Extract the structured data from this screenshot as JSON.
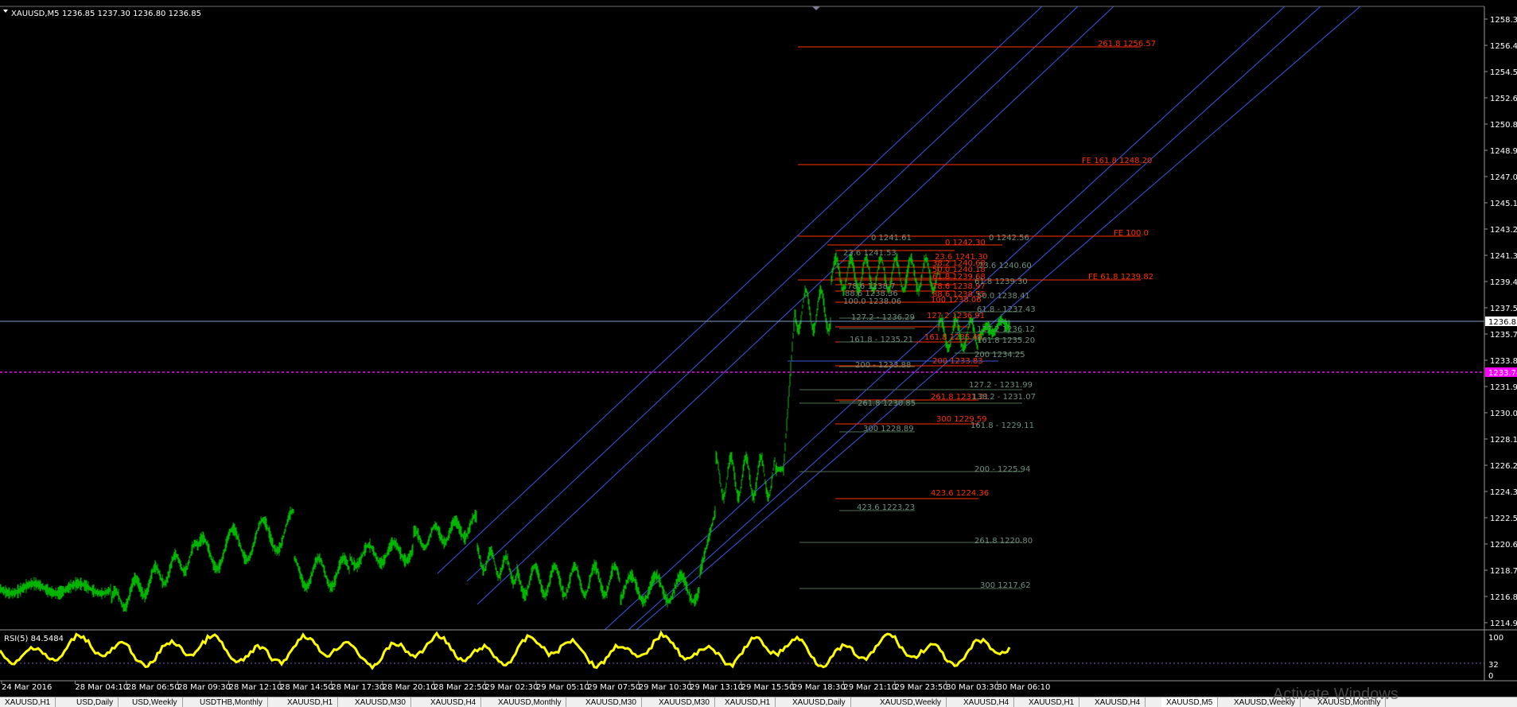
{
  "chart_header": {
    "symbol_tf": "XAUUSD,M5",
    "ohlc": "1236.85 1237.30 1236.80 1236.85"
  },
  "price_scale": {
    "labels": [
      "1258.34",
      "1256.49",
      "1254.59",
      "1252.69",
      "1250.84",
      "1248.94",
      "1247.04",
      "1245.14",
      "1243.29",
      "1241.39",
      "1239.49",
      "1237.59",
      "1235.74",
      "1233.84",
      "1231.94",
      "1230.09",
      "1228.19",
      "1226.29",
      "1224.39",
      "1222.54",
      "1220.64",
      "1218.74",
      "1216.89",
      "1214.99"
    ],
    "current_price": "1236.85",
    "level_tag": "1233.74"
  },
  "rsi": {
    "label": "RSI(5) 84.5484",
    "levels": [
      "100",
      "32",
      "0"
    ]
  },
  "time_axis": [
    "24 Mar 2016",
    "28 Mar 04:10",
    "28 Mar 06:50",
    "28 Mar 09:30",
    "28 Mar 12:10",
    "28 Mar 14:50",
    "28 Mar 17:30",
    "28 Mar 20:10",
    "28 Mar 22:50",
    "29 Mar 02:30",
    "29 Mar 05:10",
    "29 Mar 07:50",
    "29 Mar 10:30",
    "29 Mar 13:10",
    "29 Mar 15:50",
    "29 Mar 18:30",
    "29 Mar 21:10",
    "29 Mar 23:50",
    "30 Mar 03:30",
    "30 Mar 06:10"
  ],
  "fib_labels": {
    "red": [
      "261.8 1256.57",
      "FE 161.8 1248.20",
      "FE 100.0",
      "FE 61.8 1239.82",
      "0 1242.30",
      "23.6 1241.30",
      "38.2 1240.68",
      "50.0 1240.18",
      "61.8 1239.68",
      "78.6 1238.97",
      "88.6 1238.55",
      "100 1238.06",
      "127.2 1236.91",
      "161.8 1235.45",
      "200 1233.83",
      "261.8 1231.21",
      "300 1229.59",
      "423.6 1224.36"
    ],
    "gray": [
      "0 1241.61",
      "0 1242.56",
      "23.6 1241.53",
      "23.6 1240.60",
      "61.8 1239.30",
      "78.6 1238.7",
      "50.0 1238.41",
      "88.6 1238.36",
      "100.0 1238.06",
      "61.8 - 1237.43",
      "127.2 - 1236.29",
      "127.2 1236.12",
      "161.8 - 1235.21",
      "161.8 1235.20",
      "200 - 1233.88",
      "200 1234.25",
      "127.2 - 1231.99",
      "261.8 1230.85",
      "138.2 - 1231.07",
      "300 1228.89",
      "161.8 - 1229.11",
      "200 - 1225.94",
      "423.6 1223.23",
      "261.8 1220.80",
      "300 1217.62"
    ]
  },
  "tabs": [
    "XAUUSD,H1",
    "USD,Daily",
    "USD,Weekly",
    "USDTHB,Monthly",
    "XAUUSD,H1",
    "XAUUSD,M30",
    "XAUUSD,H4",
    "XAUUSD,Monthly",
    "XAUUSD,M30",
    "XAUUSD,M30",
    "XAUUSD,H1",
    "XAUUSD,Daily",
    "XAUUSD,Weekly",
    "XAUUSD,H4",
    "XAUUSD,H1",
    "XAUUSD,H4",
    "XAUUSD,M5",
    "XAUUSD,Weekly",
    "XAUUSD,Monthly"
  ],
  "active_tab_index": 16,
  "watermark": "Activate Windows",
  "colors": {
    "candles": "#00c000",
    "rsi_line": "#ffff00",
    "fib_red": "#ff3000",
    "fib_gray": "#708070",
    "channel": "#3a5adf",
    "price_line": "#7c9cc4",
    "magenta": "#ff00ff"
  }
}
